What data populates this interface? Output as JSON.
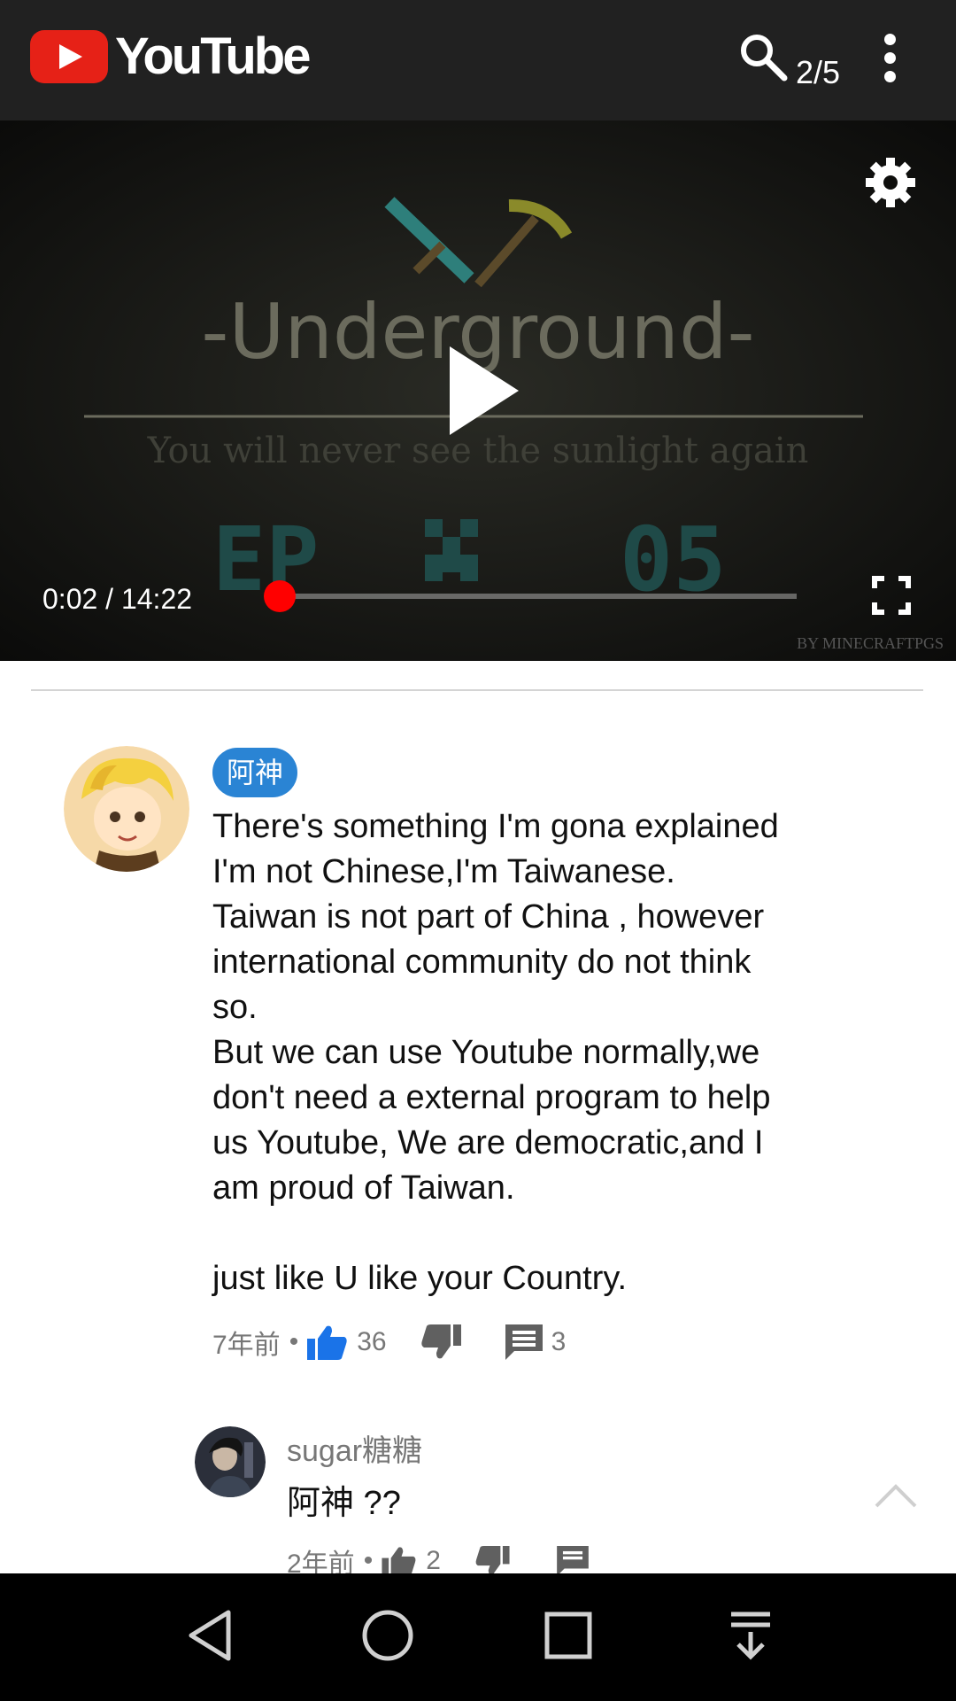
{
  "app": {
    "logo_text": "YouTube",
    "counter": "2/5",
    "brand_color": "#e62117"
  },
  "video": {
    "thumbnail_title": "-Underground-",
    "thumbnail_subtitle": "You will never see the sunlight again",
    "episode_left": "EP",
    "episode_number": "05",
    "watermark": "BY MINECRAFTPGS",
    "time_display": "0:02 / 14:22",
    "progress_fraction": 0.002,
    "progress_color": "#ff0000"
  },
  "comment": {
    "author": "阿神",
    "text": "There's something I'm gona explained\nI'm not Chinese,I'm Taiwanese.\nTaiwan is not part of China , however\ninternational community do not think\nso.\nBut we can use Youtube normally,we\ndon't need a external program to help\nus Youtube, We are democratic,and I\nam proud of Taiwan.\n\njust like U like your Country.",
    "time": "7年前",
    "dot": "•",
    "likes": "36",
    "replies": "3",
    "chip_color": "#2a84d4",
    "like_color": "#1a73e8"
  },
  "reply": {
    "author": "sugar糖糖",
    "text": "阿神 ??",
    "time": "2年前",
    "dot": "•",
    "likes": "2"
  },
  "icons": {
    "search": "search-icon",
    "more": "more-vert-icon",
    "settings": "gear-icon",
    "play": "play-icon",
    "fullscreen": "fullscreen-icon",
    "like": "thumb-up-icon",
    "dislike": "thumb-down-icon",
    "reply": "comment-icon",
    "scroll_up": "chevron-up-icon",
    "nav_back": "back-triangle-icon",
    "nav_home": "home-circle-icon",
    "nav_recents": "recents-square-icon",
    "nav_notifications": "pull-down-icon"
  }
}
